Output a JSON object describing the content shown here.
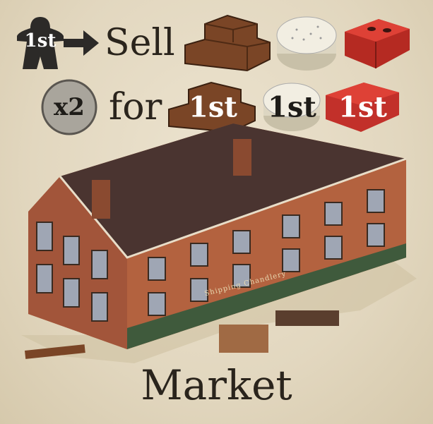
{
  "card": {
    "title": "Market",
    "rule_line1": {
      "meeple_rank": "1st",
      "arrow": "arrow-right-icon",
      "verb": "Sell",
      "goods": [
        "wood",
        "cotton",
        "brick"
      ]
    },
    "rule_line2": {
      "multiplier": "x2",
      "preposition": "for",
      "goods_ranks": [
        "1st",
        "1st",
        "1st"
      ]
    },
    "building_sign": "Shipping Chandlery",
    "colors": {
      "wood": "#7a4526",
      "cotton": "#efeadc",
      "brick": "#d23a30",
      "meeple": "#2c2a28",
      "roof": "#4a3430",
      "wall": "#b3623f"
    }
  }
}
